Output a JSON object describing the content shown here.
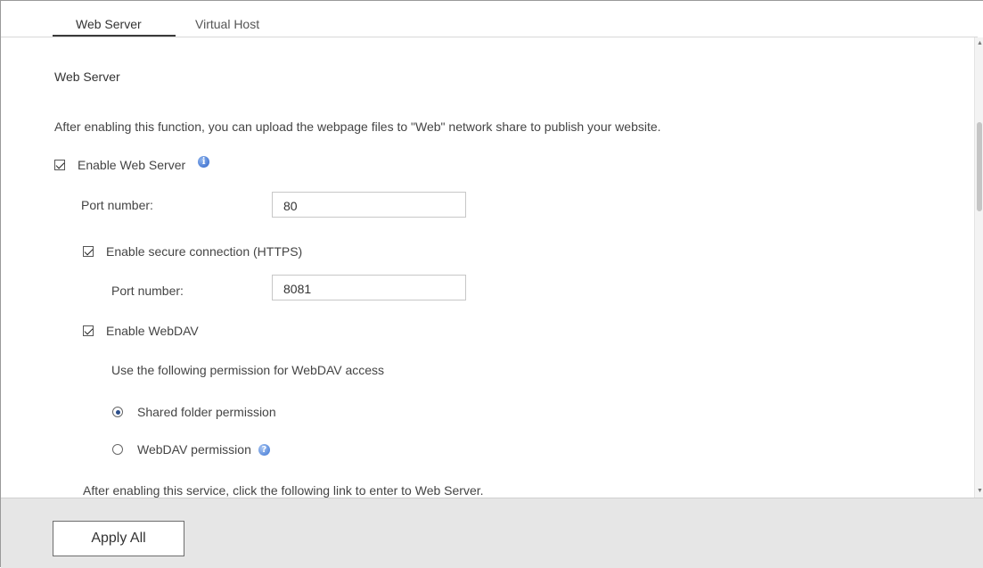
{
  "tabs": [
    {
      "label": "Web Server",
      "active": true
    },
    {
      "label": "Virtual Host",
      "active": false
    }
  ],
  "section_title": "Web Server",
  "description": "After enabling this function, you can upload the webpage files to \"Web\" network share to publish your website.",
  "enable_web_server": {
    "label": "Enable Web Server",
    "checked": true,
    "icon": "info-icon"
  },
  "port": {
    "label": "Port number:",
    "value": "80"
  },
  "https": {
    "label": "Enable secure connection (HTTPS)",
    "checked": true
  },
  "https_port": {
    "label": "Port number:",
    "value": "8081"
  },
  "webdav": {
    "label": "Enable WebDAV",
    "checked": true
  },
  "webdav_permission_label": "Use the following permission for WebDAV access",
  "permission_options": [
    {
      "label": "Shared folder permission",
      "selected": true
    },
    {
      "label": "WebDAV permission",
      "selected": false,
      "icon": "help-icon"
    }
  ],
  "link_hint": "After enabling this service, click the following link to enter to Web Server.",
  "footer": {
    "apply_label": "Apply All"
  }
}
